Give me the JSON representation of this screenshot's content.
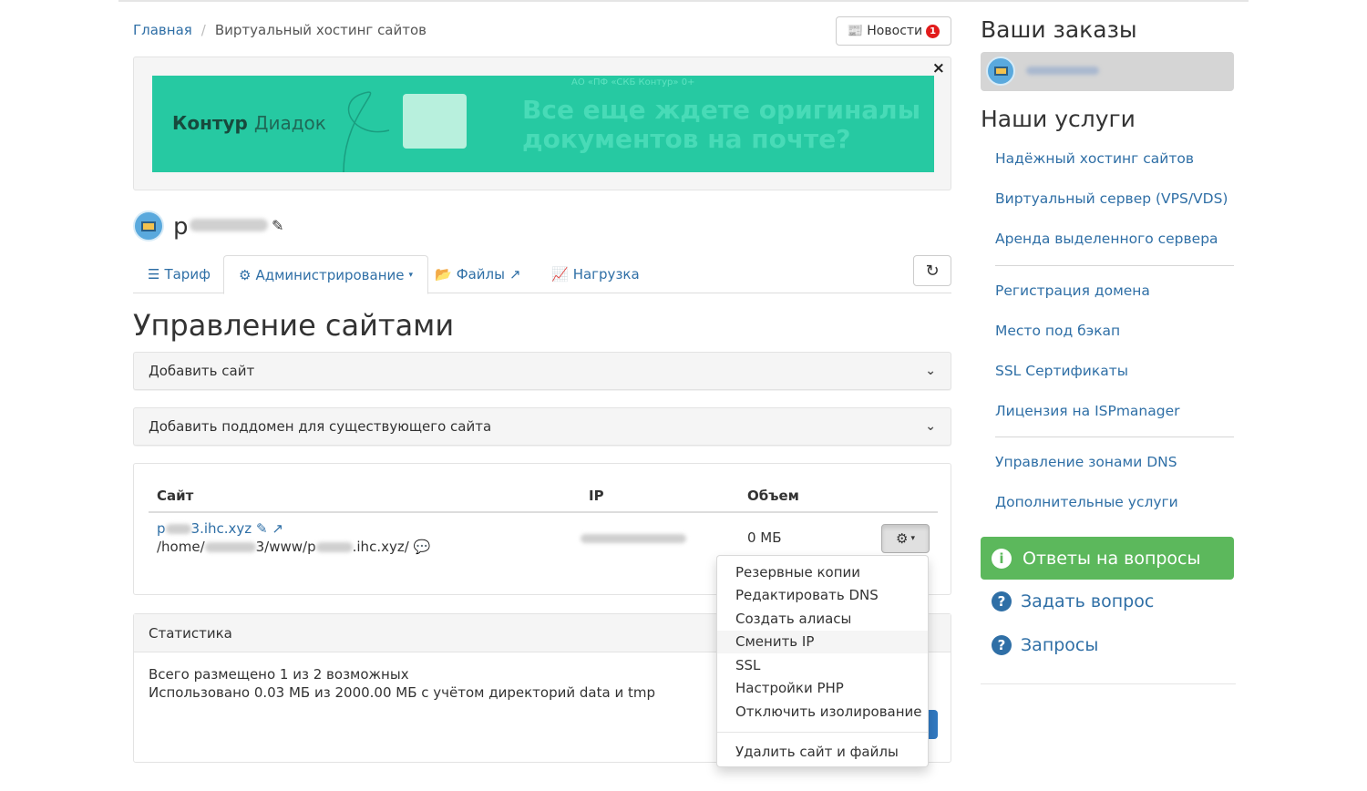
{
  "breadcrumb": {
    "home": "Главная",
    "current": "Виртуальный хостинг сайтов"
  },
  "news": {
    "label": "Новости",
    "count": "1"
  },
  "ad": {
    "close": "×",
    "logo_main": "Контур",
    "logo_sub": "Диадок",
    "legal": "АО «ПФ «СКБ Контур»   0+",
    "headline": "Все еще ждете оригиналы документов на почте?"
  },
  "account": {
    "name_prefix": "p"
  },
  "tabs": {
    "tariff": "Тариф",
    "admin": "Администрирование",
    "files": "Файлы",
    "load": "Нагрузка"
  },
  "page_title": "Управление сайтами",
  "panels": {
    "add_site": "Добавить сайт",
    "add_subdomain": "Добавить поддомен для существующего сайта"
  },
  "table": {
    "headers": {
      "site": "Сайт",
      "ip": "IP",
      "size": "Объем"
    },
    "row": {
      "site_prefix": "p",
      "site_suffix": "3.ihc.xyz",
      "path_1": "/home/",
      "path_2": "3/www/p",
      "path_3": ".ihc.xyz/",
      "size": "0 МБ"
    }
  },
  "stats": {
    "title": "Статистика",
    "line1": "Всего размещено 1 из 2 возможных",
    "line2": "Использовано 0.03 МБ из 2000.00 МБ с учётом директорий data и tmp"
  },
  "dropdown": {
    "items": [
      "Резервные копии",
      "Редактировать DNS",
      "Создать алиасы",
      "Сменить IP",
      "SSL",
      "Настройки PHP",
      "Отключить изолирование"
    ],
    "danger": "Удалить сайт и файлы"
  },
  "sidebar": {
    "orders_title": "Ваши заказы",
    "services_title": "Наши услуги",
    "services_group1": [
      "Надёжный хостинг сайтов",
      "Виртуальный сервер (VPS/VDS)",
      "Аренда выделенного сервера"
    ],
    "services_group2": [
      "Регистрация домена",
      "Место под бэкап",
      "SSL Сертификаты",
      "Лицензия на ISPmanager"
    ],
    "services_group3": [
      "Управление зонами DNS",
      "Дополнительные услуги"
    ],
    "faq": "Ответы на вопросы",
    "ask": "Задать вопрос",
    "requests": "Запросы"
  },
  "colors": {
    "link": "#2f6fa6",
    "success": "#5cb85c",
    "banner": "#26c9a2",
    "badge": "#e21b1b"
  }
}
